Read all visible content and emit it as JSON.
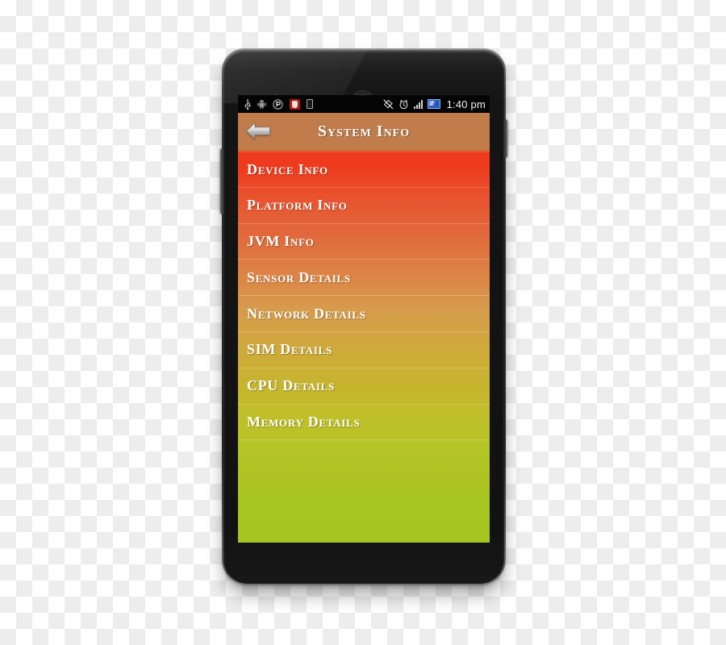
{
  "device": {
    "model_style": "android-smartphone",
    "hardware": {
      "front_camera": "front-camera",
      "earpiece": "earpiece-speaker",
      "proximity_sensor": "proximity-sensor",
      "volume_rocker": "volume-rocker-button",
      "power_button": "power-button"
    }
  },
  "screen": {
    "statusbar": {
      "left_icons": [
        {
          "name": "usb-icon",
          "label": "USB"
        },
        {
          "name": "android-debug-icon",
          "label": "Android"
        },
        {
          "name": "media-circle-icon",
          "label": "Media"
        },
        {
          "name": "app-notification-icon",
          "label": "App"
        },
        {
          "name": "device-icon",
          "label": "Device"
        }
      ],
      "right_icons": [
        {
          "name": "location-off-icon",
          "label": "Location"
        },
        {
          "name": "alarm-clock-icon",
          "label": "Alarm"
        },
        {
          "name": "signal-bars-icon",
          "label": "Signal"
        },
        {
          "name": "battery-charging-icon",
          "label": "Battery"
        }
      ],
      "time": "1:40 pm"
    },
    "actionbar": {
      "back_label": "Back",
      "title": "System Info",
      "background_color": "#c07c4b",
      "accent_color": "#d4662f"
    },
    "list": {
      "items": [
        {
          "label": "Device Info"
        },
        {
          "label": "Platform Info"
        },
        {
          "label": "JVM Info"
        },
        {
          "label": "Sensor Details"
        },
        {
          "label": "Network Details"
        },
        {
          "label": "SIM Details"
        },
        {
          "label": "CPU Details"
        },
        {
          "label": "Memory Details"
        }
      ],
      "gradient_start": "#ee3b1e",
      "gradient_end": "#a5c520"
    }
  }
}
